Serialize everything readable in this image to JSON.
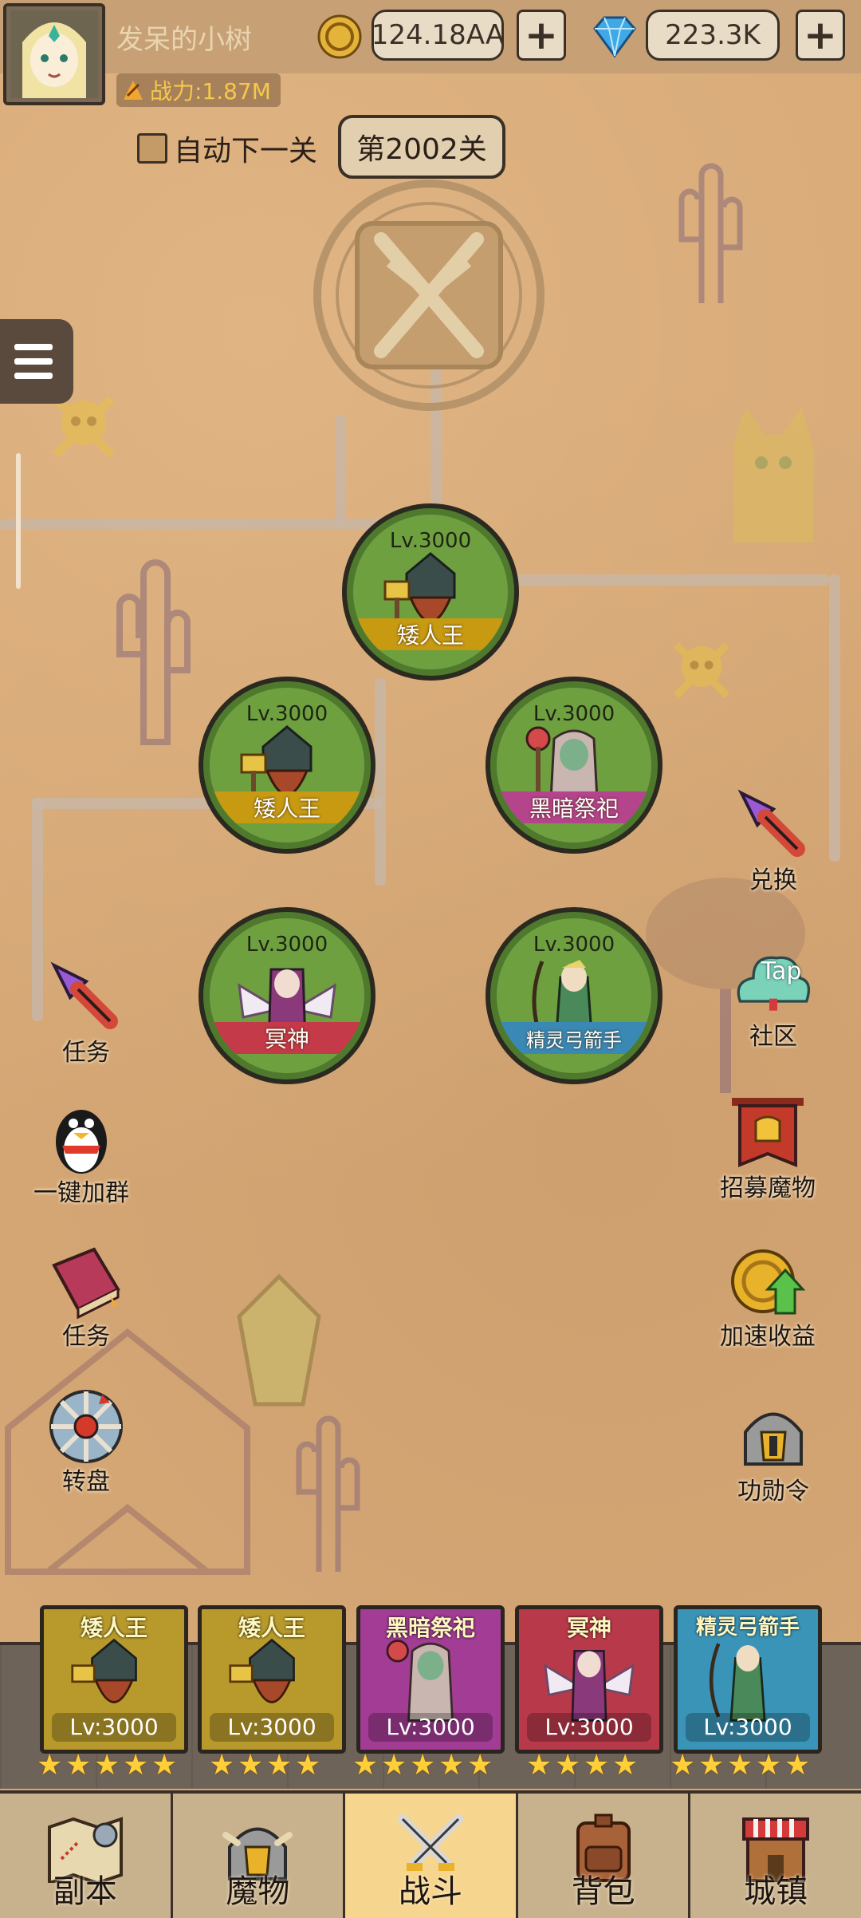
{
  "player": {
    "name": "发呆的小树",
    "power": "战力:1.87M"
  },
  "resources": {
    "gold": "124.18AA",
    "gems": "223.3K"
  },
  "stage": {
    "auto_next_label": "自动下一关",
    "current_level": "第2002关"
  },
  "enemies": [
    {
      "level": "Lv.3000",
      "name": "矮人王",
      "ribbon_color": "#c79a12"
    },
    {
      "level": "Lv.3000",
      "name": "矮人王",
      "ribbon_color": "#c79a12"
    },
    {
      "level": "Lv.3000",
      "name": "黑暗祭祀",
      "ribbon_color": "#b4448c"
    },
    {
      "level": "Lv.3000",
      "name": "冥神",
      "ribbon_color": "#c43a48"
    },
    {
      "level": "Lv.3000",
      "name": "精灵弓箭手",
      "ribbon_color": "#3a88b4"
    }
  ],
  "left_buttons": [
    {
      "label": "任务",
      "icon": "rocket-icon"
    },
    {
      "label": "一键加群",
      "icon": "penguin-icon"
    },
    {
      "label": "任务",
      "icon": "book-icon"
    },
    {
      "label": "转盘",
      "icon": "wheel-icon"
    }
  ],
  "right_buttons": [
    {
      "label": "兑换",
      "icon": "rocket-icon"
    },
    {
      "label": "社区",
      "icon": "tap-icon",
      "badge": "Tap"
    },
    {
      "label": "招募魔物",
      "icon": "banner-icon"
    },
    {
      "label": "加速收益",
      "icon": "coin-arrow-icon"
    },
    {
      "label": "功勋令",
      "icon": "helmet-icon"
    }
  ],
  "team": [
    {
      "name": "矮人王",
      "level": "Lv:3000",
      "bg": "#b89a2c",
      "stars": 5
    },
    {
      "name": "矮人王",
      "level": "Lv:3000",
      "bg": "#b89a2c",
      "stars": 4
    },
    {
      "name": "黑暗祭祀",
      "level": "Lv:3000",
      "bg": "#a23c94",
      "stars": 5
    },
    {
      "name": "冥神",
      "level": "Lv:3000",
      "bg": "#b83a4a",
      "stars": 4
    },
    {
      "name": "精灵弓箭手",
      "level": "Lv:3000",
      "bg": "#3a94b8",
      "stars": 5
    }
  ],
  "nav": [
    {
      "label": "副本",
      "icon": "map-icon"
    },
    {
      "label": "魔物",
      "icon": "monster-helmet-icon"
    },
    {
      "label": "战斗",
      "icon": "swords-icon",
      "active": true
    },
    {
      "label": "背包",
      "icon": "backpack-icon"
    },
    {
      "label": "城镇",
      "icon": "shop-icon"
    }
  ]
}
